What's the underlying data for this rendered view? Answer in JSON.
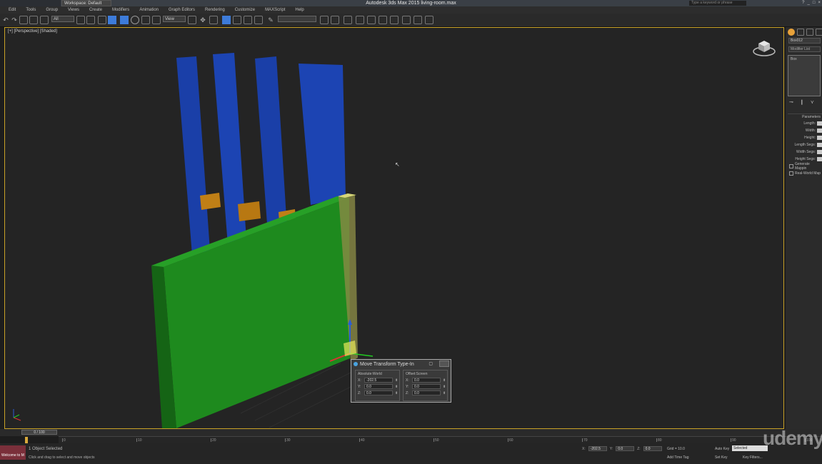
{
  "window": {
    "title": "Autodesk 3ds Max 2015    living-room.max",
    "workspace": "Workspace: Default",
    "search_placeholder": "Type a keyword or phrase",
    "buttons": [
      "?",
      "_",
      "□",
      "×"
    ]
  },
  "menu": [
    "Edit",
    "Tools",
    "Group",
    "Views",
    "Create",
    "Modifiers",
    "Animation",
    "Graph Editors",
    "Rendering",
    "Customize",
    "MAXScript",
    "Help"
  ],
  "toolbar": {
    "selection_filter": "All",
    "reference_coord": "View",
    "named_selection": ""
  },
  "viewport": {
    "label": "[+] [Perspective] [Shaded]",
    "cursor_glyph": "↖"
  },
  "move_dialog": {
    "title": "Move Transform Type-In",
    "absolute_label": "Absolute:World",
    "offset_label": "Offset:Screen",
    "absolute": {
      "x": "-202.5",
      "y": "0.0",
      "z": "0.0"
    },
    "offset": {
      "x": "0.0",
      "y": "0.0",
      "z": "0.0"
    },
    "axes": [
      "X:",
      "Y:",
      "Z:"
    ]
  },
  "command_panel": {
    "object_name": "Box012",
    "modifier_list": "Modifier List",
    "stack_item": "Box",
    "rollout_title": "Parameters",
    "params": [
      "Length:",
      "Width:",
      "Height:",
      "Length Segs:",
      "Width Segs:",
      "Height Segs:"
    ],
    "check1": "Generate Mappin",
    "check2": "Real-World Map"
  },
  "timeline": {
    "slider": "0 / 100",
    "ticks": [
      "0",
      "10",
      "20",
      "30",
      "40",
      "50",
      "60",
      "70",
      "80",
      "90",
      "100"
    ]
  },
  "status": {
    "maxscript_label": "Welcome to M",
    "line1": "1 Object Selected",
    "line2": "Click and drag to select and move objects",
    "x": "-202.5",
    "y": "0.0",
    "z": "0.0",
    "grid": "Grid = 10.0",
    "add_time_tag": "Add Time Tag",
    "auto_key": "Auto Key",
    "set_key": "Set Key",
    "selected": "Selected",
    "key_filters": "Key Filters..."
  },
  "watermark": "udemy",
  "colors": {
    "viewport_border": "#c9a227",
    "green_box": "#1e8a1e",
    "blue_box": "#1a3fa8",
    "orange_box": "#c07f16",
    "selection_yellow": "#d6d67a"
  }
}
